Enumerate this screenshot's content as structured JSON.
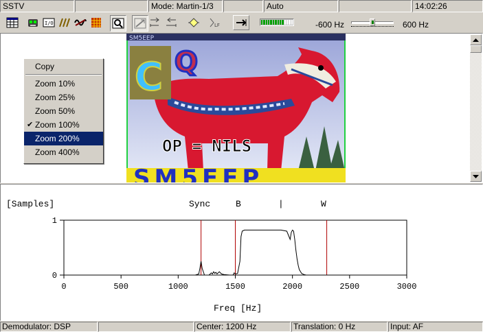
{
  "top_status": {
    "mode_name": "SSTV",
    "mode": "Mode: Martin-1/3",
    "sync": "Auto",
    "time": "14:02:26"
  },
  "toolbar": {
    "level_segments_on": 10,
    "level_segments_total": 14,
    "freq_low": "-600 Hz",
    "freq_high": "600 Hz",
    "offset_value": 0.5
  },
  "image": {
    "callsign": "SM5EEP",
    "caption": "OP = NILS",
    "logo_text": "SM5EEP",
    "letters": "C Q"
  },
  "context_menu": {
    "items": [
      {
        "label": "Copy",
        "checked": false,
        "selected": false
      },
      {
        "label": "Zoom 10%",
        "checked": false,
        "selected": false
      },
      {
        "label": "Zoom 25%",
        "checked": false,
        "selected": false
      },
      {
        "label": "Zoom 50%",
        "checked": false,
        "selected": false
      },
      {
        "label": "Zoom 100%",
        "checked": true,
        "selected": false
      },
      {
        "label": "Zoom 200%",
        "checked": false,
        "selected": true
      },
      {
        "label": "Zoom 400%",
        "checked": false,
        "selected": false
      }
    ]
  },
  "spectrum": {
    "samples_label": "[Samples]",
    "marker_sync": "Sync",
    "marker_b": "B",
    "marker_bar": "|",
    "marker_w": "W",
    "xlabel": "Freq [Hz]",
    "x_ticks": [
      "0",
      "500",
      "1000",
      "1500",
      "2000",
      "2500",
      "3000"
    ],
    "y_ticks": [
      "1",
      "0"
    ],
    "line_color": "#000000",
    "marker_color": "#b00000"
  },
  "chart_data": {
    "type": "line",
    "title": "",
    "xlabel": "Freq [Hz]",
    "ylabel": "[Samples]",
    "xlim": [
      0,
      3000
    ],
    "ylim": [
      0,
      1
    ],
    "grid": false,
    "vertical_markers": [
      {
        "label": "Sync",
        "x": 1200
      },
      {
        "label": "B",
        "x": 1500
      },
      {
        "label": "W",
        "x": 2300
      }
    ],
    "series": [
      {
        "x": [
          0,
          1150,
          1180,
          1190,
          1200,
          1210,
          1230,
          1270,
          1290,
          1300,
          1310,
          1320,
          1330,
          1340,
          1360,
          1380,
          1400,
          1450,
          1480,
          1490,
          1500,
          1520,
          1540,
          1550,
          1560,
          1580,
          1600,
          1650,
          1700,
          1800,
          1900,
          1950,
          1980,
          1990,
          2000,
          2010,
          2020,
          2030,
          2040,
          2050,
          2060,
          2080,
          2100,
          2120,
          3000
        ],
        "y": [
          0,
          0,
          0.02,
          0.12,
          0.25,
          0.12,
          0,
          0,
          0.04,
          0.02,
          0.06,
          0.03,
          0.05,
          0.02,
          0.06,
          0.02,
          0.01,
          0,
          0,
          0.04,
          0.02,
          0.03,
          0.25,
          0.7,
          0.8,
          0.82,
          0.82,
          0.82,
          0.82,
          0.82,
          0.82,
          0.8,
          0.65,
          0.78,
          0.82,
          0.8,
          0.65,
          0.45,
          0.3,
          0.18,
          0.1,
          0.03,
          0.01,
          0,
          0
        ]
      }
    ]
  },
  "status_bar": {
    "demodulator": "Demodulator: DSP",
    "blank": "",
    "center": "Center: 1200 Hz",
    "translation": "Translation: 0 Hz",
    "input": "Input: AF"
  }
}
